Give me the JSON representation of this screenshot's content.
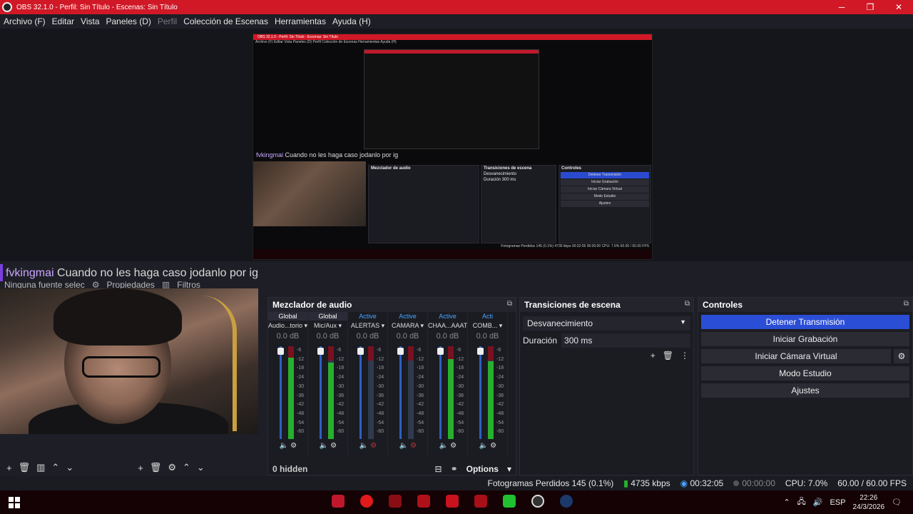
{
  "window": {
    "title": "OBS 32.1.0 - Perfil: Sin Título - Escenas: Sin Título",
    "min": "─",
    "max": "❐",
    "close": "✕"
  },
  "menu": {
    "items": [
      "Archivo (F)",
      "Editar",
      "Vista",
      "Paneles (D)",
      "Perfil",
      "Colección de Escenas",
      "Herramientas",
      "Ayuda (H)"
    ]
  },
  "nested_preview": {
    "title": "OBS 32.1.0 - Perfil: Sin Título - Escenas: Sin Título",
    "menu": "Archivo (F)   Editar   Vista   Paneles (D)   Perfil   Colección de Escenas   Herramientas   Ayuda (H)",
    "chat_user": "fvkingmai",
    "chat_text": " Cuando no les haga caso jodanlo por ig",
    "mixer_title": "Mezclador de audio",
    "trans_title": "Transiciones de escena",
    "trans_value": "Desvanecimiento",
    "trans_dur": "Duración  300 ms",
    "ctrl_title": "Controles",
    "ctrl_buttons": [
      "Detener Transmisión",
      "Iniciar Grabación",
      "Iniciar Cámara Virtual",
      "Modo Estudio",
      "Ajustes"
    ],
    "status": "Fotogramas Perdidos 145 (0.1%)   4735 kbps   00:32:05   00:00:00   CPU: 7.6%   60.00 / 60.00 FPS"
  },
  "chat": {
    "user": "fvkingmai",
    "text": " Cuando no les haga caso jodanlo por ig"
  },
  "source_bar": {
    "no_source": "Ninguna fuente selec",
    "properties": "Propiedades",
    "filters": "Filtros"
  },
  "mixer": {
    "title": "Mezclador de audio",
    "channels": [
      {
        "tag": "Global",
        "name": "Audio...torio",
        "db": "0.0 dB",
        "level": 0.88,
        "muted": false
      },
      {
        "tag": "Global",
        "name": "Mic/Aux",
        "db": "0.0 dB",
        "level": 0.82,
        "muted": false
      },
      {
        "tag": "Active",
        "name": "ALERTAS",
        "db": "0.0 dB",
        "level": 0.0,
        "muted": true
      },
      {
        "tag": "Active",
        "name": "CAMARA",
        "db": "0.0 dB",
        "level": 0.0,
        "muted": true
      },
      {
        "tag": "Active",
        "name": "CHAA...AAAT",
        "db": "0.0 dB",
        "level": 0.86,
        "muted": false
      },
      {
        "tag": "Acti",
        "name": "COMB...",
        "db": "0.0 dB",
        "level": 0.84,
        "muted": false
      }
    ],
    "scale": [
      "-6",
      "-12",
      "-18",
      "-24",
      "-30",
      "-36",
      "-42",
      "-48",
      "-54",
      "-60"
    ],
    "hidden": "0 hidden",
    "options": "Options"
  },
  "transitions": {
    "title": "Transiciones de escena",
    "selected": "Desvanecimiento",
    "duration_label": "Duración",
    "duration_value": "300 ms"
  },
  "controls": {
    "title": "Controles",
    "stop_stream": "Detener Transmisión",
    "start_record": "Iniciar Grabación",
    "start_virtualcam": "Iniciar Cámara Virtual",
    "studio_mode": "Modo Estudio",
    "settings": "Ajustes"
  },
  "status": {
    "dropped": "Fotogramas Perdidos 145 (0.1%)",
    "bitrate": "4735 kbps",
    "stream_time": "00:32:05",
    "record_time": "00:00:00",
    "cpu": "CPU: 7.0%",
    "fps": "60.00 / 60.00 FPS"
  },
  "taskbar": {
    "lang": "ESP",
    "time": "22:26",
    "date": "24/3/2026"
  }
}
